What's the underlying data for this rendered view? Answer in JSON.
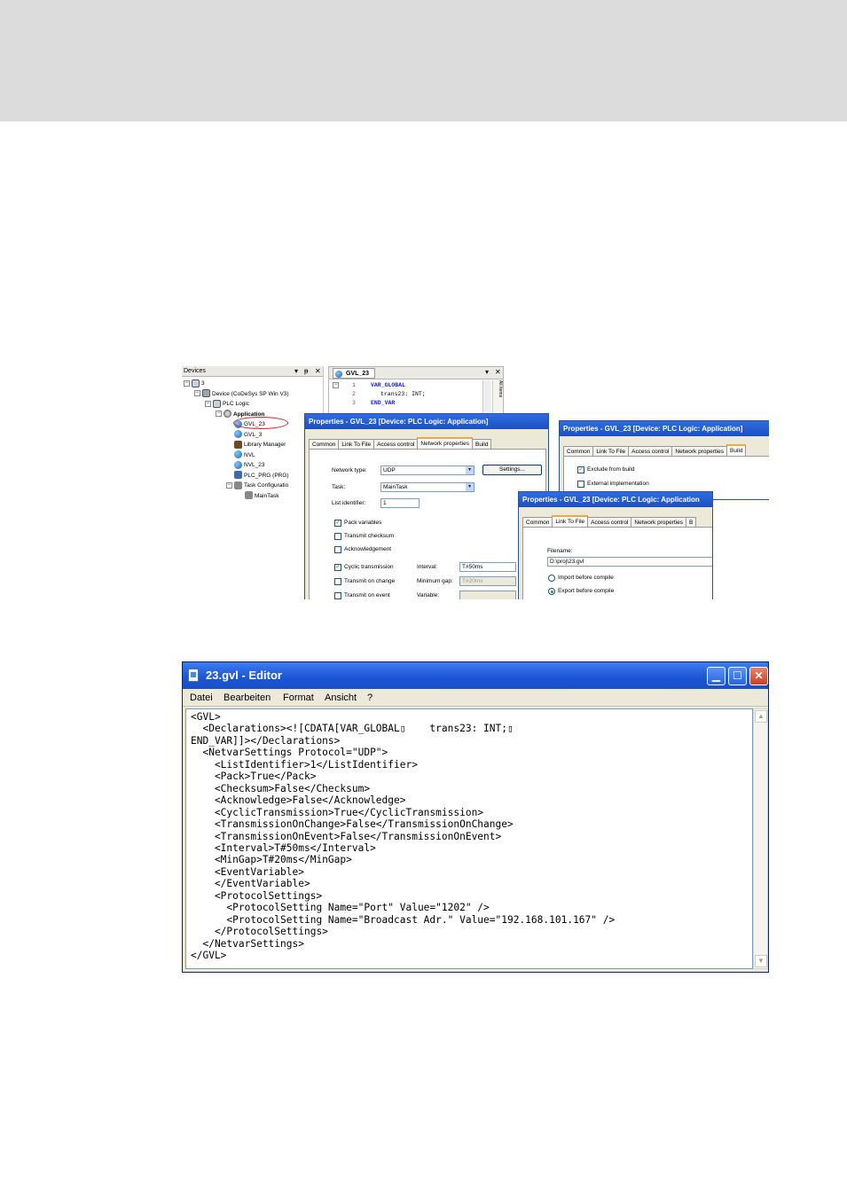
{
  "devices_panel": {
    "header": "Devices",
    "tree": [
      {
        "label": "3",
        "indent": 0,
        "icon": "project-icon",
        "expander": "−"
      },
      {
        "label": "Device (CoDeSys SP Win V3)",
        "indent": 1,
        "icon": "device-icon",
        "expander": "−"
      },
      {
        "label": "PLC Logic",
        "indent": 2,
        "icon": "plc-logic-icon",
        "expander": "−"
      },
      {
        "label": "Application",
        "indent": 3,
        "icon": "application-icon",
        "expander": "−"
      },
      {
        "label": "GVL_23",
        "indent": 4,
        "icon": "gvl-icon",
        "expander": ""
      },
      {
        "label": "GVL_3",
        "indent": 4,
        "icon": "gvl-icon",
        "expander": ""
      },
      {
        "label": "Library Manager",
        "indent": 4,
        "icon": "library-icon",
        "expander": ""
      },
      {
        "label": "NVL",
        "indent": 4,
        "icon": "gvl-icon",
        "expander": ""
      },
      {
        "label": "NVL_23",
        "indent": 4,
        "icon": "gvl-icon",
        "expander": ""
      },
      {
        "label": "PLC_PRG (PRG)",
        "indent": 4,
        "icon": "program-icon",
        "expander": ""
      },
      {
        "label": "Task Configuratio",
        "indent": 4,
        "icon": "task-config-icon",
        "expander": "−"
      },
      {
        "label": "MainTask",
        "indent": 5,
        "icon": "task-icon",
        "expander": ""
      }
    ]
  },
  "code_panel": {
    "tab": "GVL_23",
    "lines": [
      {
        "num": "1",
        "text": "VAR_GLOBAL"
      },
      {
        "num": "2",
        "text": "trans23: INT;"
      },
      {
        "num": "3",
        "text": "END_VAR"
      }
    ]
  },
  "dialog_network": {
    "title": "Properties - GVL_23 [Device: PLC Logic: Application]",
    "tabs": [
      "Common",
      "Link To File",
      "Access control",
      "Network properties",
      "Build"
    ],
    "active_tab": "Network properties",
    "network_type_label": "Network type:",
    "network_type_value": "UDP",
    "settings_button": "Settings...",
    "task_label": "Task:",
    "task_value": "MainTask",
    "list_identifier_label": "List identifier:",
    "list_identifier_value": "1",
    "pack_variables": "Pack variables",
    "transmit_checksum": "Transmit checksum",
    "acknowledgement": "Acknowledgement",
    "cyclic_transmission": "Cyclic transmission",
    "interval_label": "Interval:",
    "interval_value": "T#50ms",
    "transmit_on_change": "Transmit on change",
    "minimum_gap_label": "Minimum gap:",
    "minimum_gap_value": "T#20ms",
    "transmit_on_event": "Transmit on event",
    "variable_label": "Variable:"
  },
  "dialog_build": {
    "title": "Properties - GVL_23 [Device: PLC Logic: Application]",
    "tabs": [
      "Common",
      "Link To File",
      "Access control",
      "Network properties",
      "Build"
    ],
    "active_tab": "Build",
    "exclude_from_build": "Exclude from build",
    "external_implementation": "External implementation"
  },
  "dialog_link": {
    "title": "Properties - GVL_23 [Device: PLC Logic: Application",
    "tabs": [
      "Common",
      "Link To File",
      "Access control",
      "Network properties",
      "B"
    ],
    "active_tab": "Link To File",
    "filename_label": "Filename:",
    "filename_value": "D:\\proj\\23.gvl",
    "import_before_compile": "Import before compile",
    "export_before_compile": "Export before compile"
  },
  "editor": {
    "title": "23.gvl - Editor",
    "menu": [
      "Datei",
      "Bearbeiten",
      "Format",
      "Ansicht",
      "?"
    ],
    "content": "<GVL>\n  <Declarations><![CDATA[VAR_GLOBAL▯    trans23: INT;▯\nEND_VAR]]></Declarations>\n  <NetvarSettings Protocol=\"UDP\">\n    <ListIdentifier>1</ListIdentifier>\n    <Pack>True</Pack>\n    <Checksum>False</Checksum>\n    <Acknowledge>False</Acknowledge>\n    <CyclicTransmission>True</CyclicTransmission>\n    <TransmissionOnChange>False</TransmissionOnChange>\n    <TransmissionOnEvent>False</TransmissionOnEvent>\n    <Interval>T#50ms</Interval>\n    <MinGap>T#20ms</MinGap>\n    <EventVariable>\n    </EventVariable>\n    <ProtocolSettings>\n      <ProtocolSetting Name=\"Port\" Value=\"1202\" />\n      <ProtocolSetting Name=\"Broadcast Adr.\" Value=\"192.168.101.167\" />\n    </ProtocolSettings>\n  </NetvarSettings>\n</GVL>"
  },
  "colors": {
    "title_bar": "#1c4fc2",
    "dialog_face": "#ece9d8",
    "keyword": "#1f1fbf",
    "highlight_ellipse": "#e02020",
    "check_mark": "#21a121"
  }
}
